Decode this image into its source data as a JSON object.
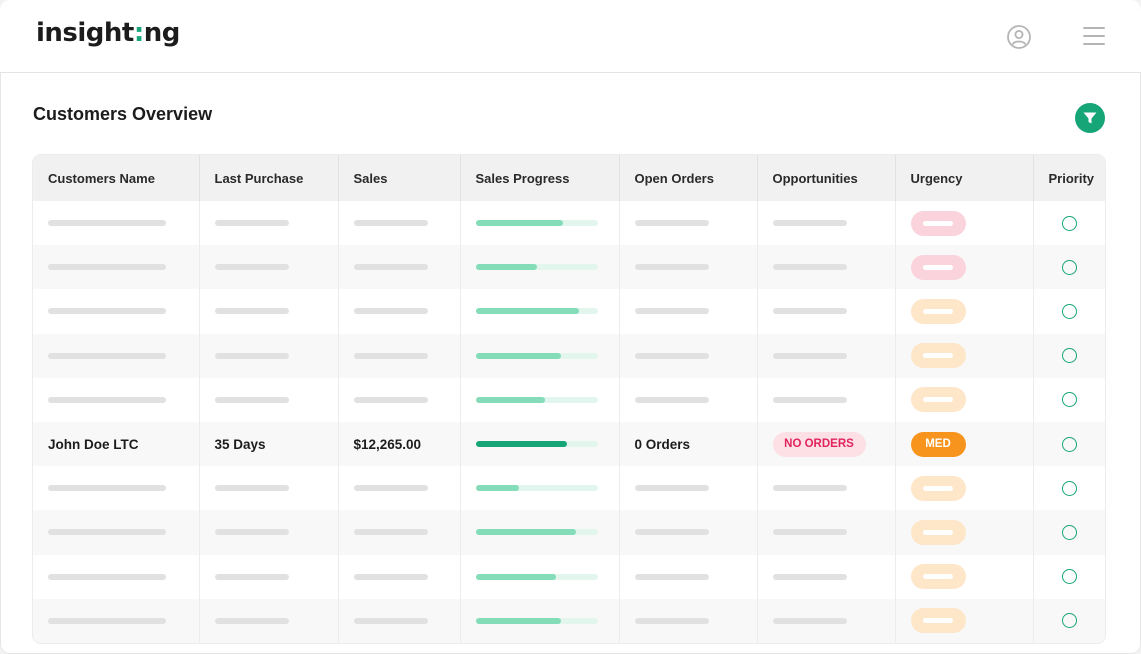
{
  "app": {
    "logo_prefix": "insight",
    "logo_dot": ":",
    "logo_suffix": "ng"
  },
  "page": {
    "title": "Customers Overview"
  },
  "colors": {
    "accent": "#16a577",
    "progress_light": "#84dcb8",
    "urgency_high": "#fbd3dc",
    "urgency_med": "#fde7c8",
    "badge_med": "#f7941d",
    "badge_no_orders_text": "#e0245e"
  },
  "icons": {
    "user": "user-circle-icon",
    "menu": "hamburger-menu-icon",
    "filter": "filter-funnel-icon",
    "priority": "circle-outline-icon"
  },
  "table": {
    "columns": [
      "Customers Name",
      "Last Purchase",
      "Sales",
      "Sales Progress",
      "Open Orders",
      "Opportunities",
      "Urgency",
      "Priority"
    ],
    "rows": [
      {
        "placeholder": true,
        "progress": 0.72,
        "urgency": "high"
      },
      {
        "placeholder": true,
        "progress": 0.5,
        "urgency": "high"
      },
      {
        "placeholder": true,
        "progress": 0.85,
        "urgency": "med"
      },
      {
        "placeholder": true,
        "progress": 0.7,
        "urgency": "med"
      },
      {
        "placeholder": true,
        "progress": 0.57,
        "urgency": "med"
      },
      {
        "placeholder": false,
        "name": "John Doe LTC",
        "last_purchase": "35 Days",
        "sales": "$12,265.00",
        "progress": 0.75,
        "open_orders": "0 Orders",
        "opportunities": "NO ORDERS",
        "urgency_label": "MED"
      },
      {
        "placeholder": true,
        "progress": 0.36,
        "urgency": "med"
      },
      {
        "placeholder": true,
        "progress": 0.82,
        "urgency": "med"
      },
      {
        "placeholder": true,
        "progress": 0.66,
        "urgency": "med"
      },
      {
        "placeholder": true,
        "progress": 0.7,
        "urgency": "med"
      }
    ]
  }
}
